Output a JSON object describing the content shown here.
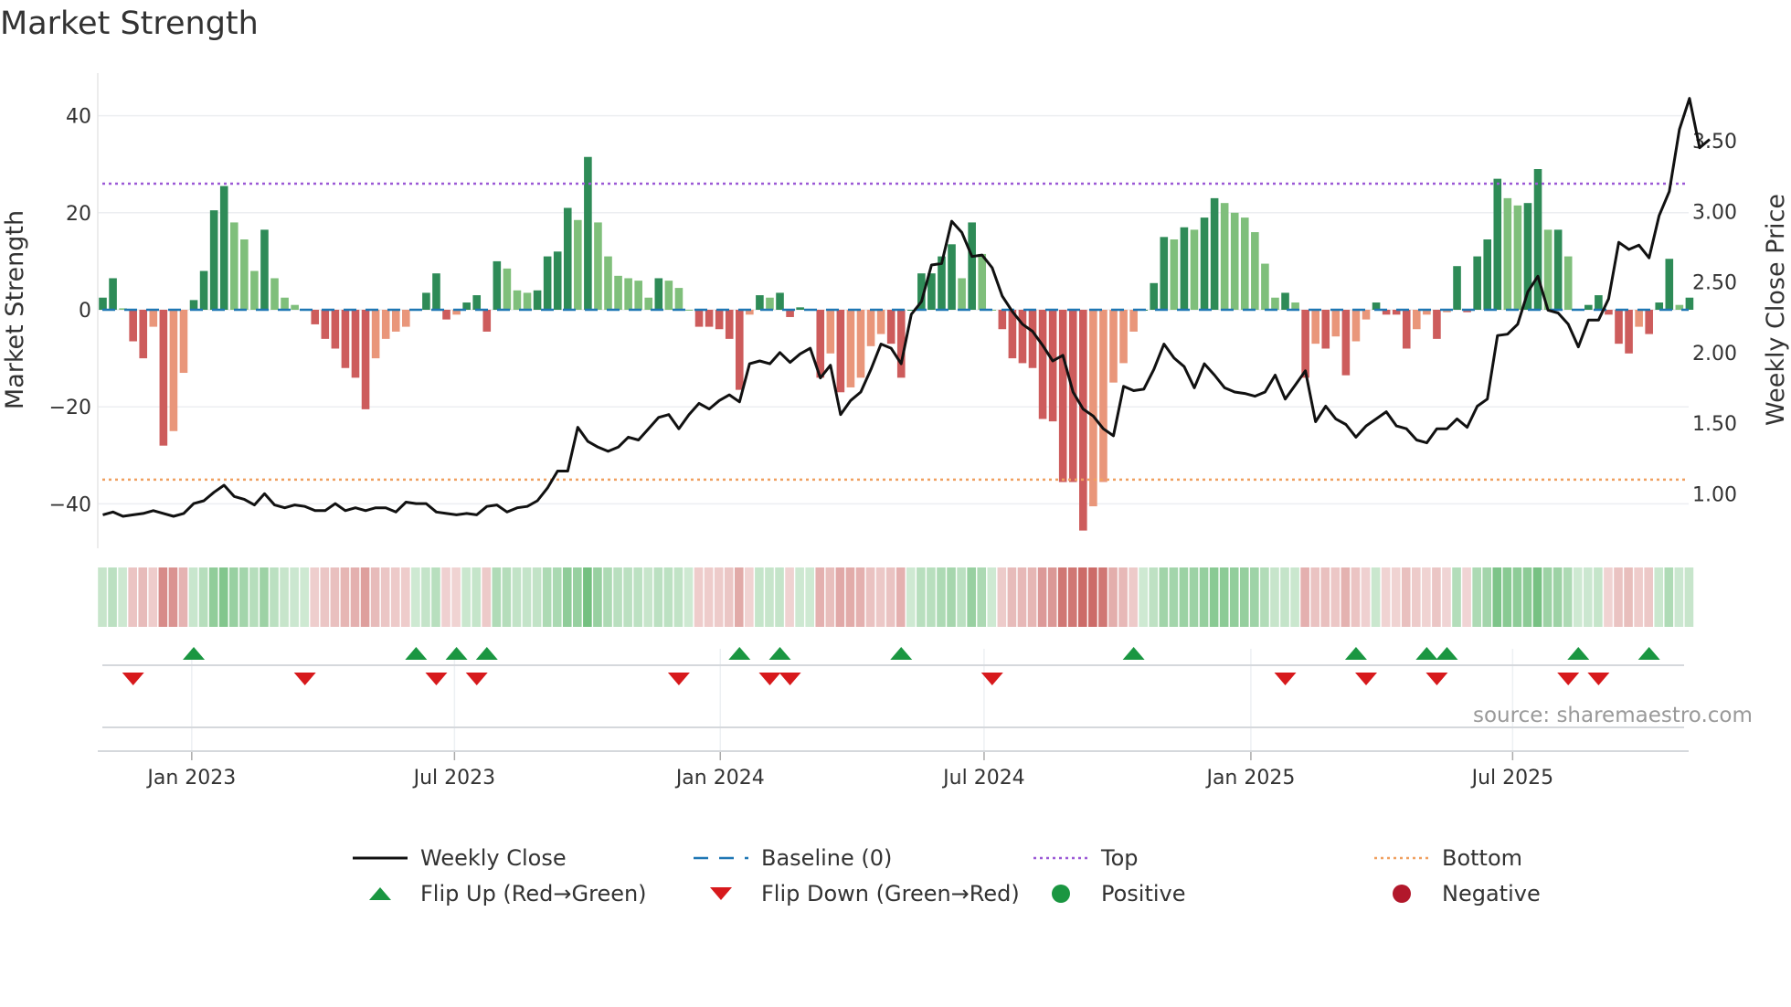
{
  "title": "Market Strength",
  "source": "source: sharemaestro.com",
  "colors": {
    "strong_up": "#2e8b57",
    "weak_up": "#7fbf7b",
    "strong_down": "#cd5c5c",
    "weak_down": "#e9967a",
    "baseline": "#1f77b4",
    "top": "#9b59d6",
    "bottom": "#f0a060",
    "price": "#111111",
    "flip_up": "#1a9641",
    "flip_down": "#d7191c",
    "positive": "#1a9641",
    "negative": "#b2182b"
  },
  "legend": [
    {
      "label": "Weekly Close",
      "kind": "line"
    },
    {
      "label": "Baseline (0)",
      "kind": "dash"
    },
    {
      "label": "Top",
      "kind": "dot-top"
    },
    {
      "label": "Bottom",
      "kind": "dot-bottom"
    },
    {
      "label": "Flip Up (Red→Green)",
      "kind": "tri-up"
    },
    {
      "label": "Flip Down (Green→Red)",
      "kind": "tri-down"
    },
    {
      "label": "Positive",
      "kind": "circle-pos"
    },
    {
      "label": "Negative",
      "kind": "circle-neg"
    }
  ],
  "chart_data": {
    "type": "bar",
    "title": "Market Strength",
    "ylabel": "Market Strength",
    "y2label": "Weekly Close Price",
    "ylim": [
      -50,
      48
    ],
    "y2lim": [
      0.71,
      3.92
    ],
    "yticks": [
      -40,
      -20,
      0,
      20,
      40
    ],
    "yticklabels": [
      "−40",
      "−20",
      "0",
      "20",
      "40"
    ],
    "y2ticks": [
      1.0,
      1.5,
      2.0,
      2.5,
      3.0,
      3.5
    ],
    "y2ticklabels": [
      "1.00",
      "1.50",
      "2.00",
      "2.50",
      "3.00",
      "3.50"
    ],
    "top_level": 26,
    "bottom_level": -35,
    "baseline": 0,
    "xticks": [
      {
        "label": "Jan 2023",
        "week": 8.8
      },
      {
        "label": "Jul 2023",
        "week": 34.8
      },
      {
        "label": "Jan 2024",
        "week": 61.1
      },
      {
        "label": "Jul 2024",
        "week": 87.2
      },
      {
        "label": "Jan 2025",
        "week": 113.6
      },
      {
        "label": "Jul 2025",
        "week": 139.5
      }
    ],
    "strength": [
      2.5,
      6.5,
      0.3,
      -6.5,
      -10,
      -3.5,
      -28,
      -25,
      -13,
      2,
      8,
      20.5,
      25.5,
      18,
      14.5,
      8,
      16.5,
      6.5,
      2.5,
      1,
      0,
      -3,
      -6,
      -8,
      -12,
      -14,
      -20.5,
      -10,
      -6,
      -4.5,
      -3.5,
      0,
      3.5,
      7.5,
      -2,
      -1,
      1.5,
      3,
      -4.5,
      10,
      8.5,
      4,
      3.5,
      4,
      11,
      12,
      21,
      18.5,
      31.5,
      18,
      11,
      7,
      6.5,
      6,
      2.5,
      6.5,
      6,
      4.5,
      0,
      -3.5,
      -3.5,
      -4,
      -6,
      -16.5,
      -1,
      3,
      2.5,
      3.5,
      -1.5,
      0.5,
      0,
      -14,
      -9,
      -17,
      -16,
      -14,
      -7.5,
      -5,
      -7,
      -14,
      0,
      7.5,
      7.5,
      11,
      13.5,
      6.5,
      18,
      11.5,
      0,
      -4,
      -10,
      -11,
      -12,
      -22.5,
      -23,
      -35.5,
      -35.5,
      -45.5,
      -40.5,
      -35.5,
      -15,
      -11,
      -4.5,
      0,
      5.5,
      15,
      14.5,
      17,
      16.5,
      19,
      23,
      22,
      20,
      19,
      16,
      9.5,
      2.5,
      3.5,
      1.5,
      -14,
      -7,
      -8,
      -5.5,
      -13.5,
      -6.5,
      -2,
      1.5,
      -1,
      -1,
      -8,
      -4,
      -1,
      -6,
      -0.5,
      9,
      -0.5,
      11,
      14.5,
      27,
      23,
      21.5,
      22,
      29,
      16.5,
      16.5,
      11,
      0,
      1,
      3,
      -1,
      -7,
      -9,
      -3.5,
      -5,
      1.5,
      10.5,
      1,
      2.5
    ],
    "price": [
      0.85,
      0.87,
      0.84,
      0.85,
      0.86,
      0.88,
      0.86,
      0.84,
      0.86,
      0.93,
      0.95,
      1.01,
      1.06,
      0.98,
      0.96,
      0.92,
      1.0,
      0.92,
      0.9,
      0.92,
      0.91,
      0.88,
      0.88,
      0.93,
      0.88,
      0.9,
      0.88,
      0.9,
      0.9,
      0.87,
      0.94,
      0.93,
      0.93,
      0.87,
      0.86,
      0.85,
      0.86,
      0.85,
      0.91,
      0.92,
      0.87,
      0.9,
      0.91,
      0.95,
      1.04,
      1.16,
      1.16,
      1.47,
      1.37,
      1.33,
      1.3,
      1.33,
      1.4,
      1.38,
      1.46,
      1.54,
      1.56,
      1.46,
      1.56,
      1.64,
      1.6,
      1.66,
      1.7,
      1.65,
      1.92,
      1.94,
      1.92,
      2.0,
      1.93,
      1.99,
      2.03,
      1.82,
      1.91,
      1.56,
      1.66,
      1.72,
      1.88,
      2.06,
      2.03,
      1.92,
      2.27,
      2.36,
      2.62,
      2.63,
      2.93,
      2.85,
      2.68,
      2.69,
      2.6,
      2.4,
      2.29,
      2.2,
      2.15,
      2.05,
      1.94,
      1.98,
      1.72,
      1.6,
      1.55,
      1.46,
      1.41,
      1.76,
      1.73,
      1.74,
      1.88,
      2.06,
      1.96,
      1.9,
      1.75,
      1.92,
      1.84,
      1.75,
      1.72,
      1.71,
      1.69,
      1.72,
      1.84,
      1.67,
      1.77,
      1.87,
      1.51,
      1.62,
      1.53,
      1.49,
      1.4,
      1.48,
      1.53,
      1.58,
      1.48,
      1.46,
      1.38,
      1.36,
      1.46,
      1.46,
      1.53,
      1.47,
      1.62,
      1.67,
      2.12,
      2.13,
      2.2,
      2.43,
      2.54,
      2.3,
      2.28,
      2.2,
      2.04,
      2.23,
      2.23,
      2.38,
      2.78,
      2.73,
      2.76,
      2.67,
      2.97,
      3.14,
      3.58,
      3.8,
      3.45,
      3.51
    ],
    "flip_up_weeks": [
      9,
      31,
      35,
      38,
      63,
      67,
      79,
      102,
      124,
      131,
      133,
      146,
      153
    ],
    "flip_down_weeks": [
      3,
      20,
      33,
      37,
      57,
      66,
      68,
      88,
      117,
      125,
      132,
      145,
      148
    ]
  }
}
